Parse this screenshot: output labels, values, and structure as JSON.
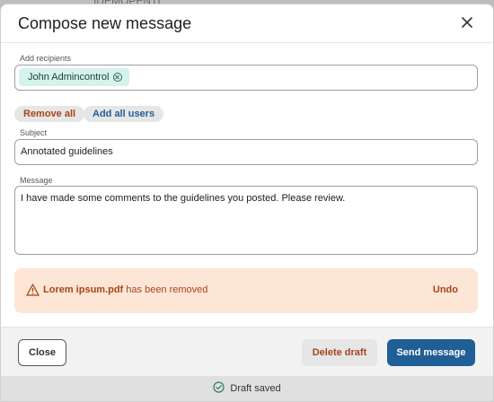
{
  "background_text": "IDEMOPENTI",
  "dialog": {
    "title": "Compose new message"
  },
  "recipients": {
    "label": "Add recipients",
    "chips": [
      {
        "name": "John Admincontrol"
      }
    ],
    "remove_all_label": "Remove all",
    "add_all_label": "Add all users"
  },
  "subject": {
    "label": "Subject",
    "value": "Annotated guidelines"
  },
  "message": {
    "label": "Message",
    "value": "I have made some comments to the guidelines you posted. Please review."
  },
  "alert": {
    "filename": "Lorem ipsum.pdf",
    "text": " has been removed",
    "undo_label": "Undo",
    "icon": "warning-icon"
  },
  "footer": {
    "close_label": "Close",
    "delete_label": "Delete draft",
    "send_label": "Send message"
  },
  "status": {
    "text": "Draft saved",
    "icon": "check-circle-icon"
  },
  "colors": {
    "primary": "#1f5f96",
    "danger": "#a8441a",
    "chip_bg": "#d4f3ec",
    "alert_bg": "#fde6d6"
  }
}
